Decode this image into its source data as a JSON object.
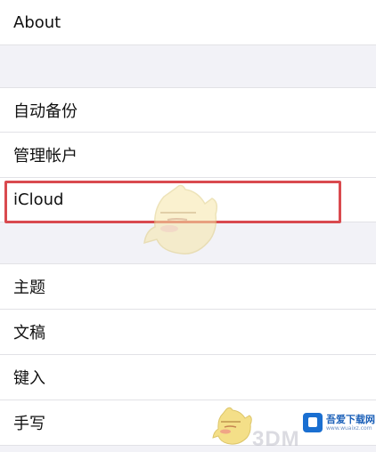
{
  "settings": {
    "about_label": "About",
    "group1": {
      "auto_backup": "自动备份",
      "manage_accounts": "管理帐户",
      "icloud": "iCloud"
    },
    "group2": {
      "theme": "主题",
      "draft": "文稿",
      "keyboard_input": "键入",
      "handwriting": "手写"
    }
  },
  "watermark": {
    "brand": "3DM",
    "site_name": "吾爱下载网",
    "site_url": "www.wuaixz.com"
  },
  "colors": {
    "highlight_border": "#d94a4f",
    "background": "#f2f2f7",
    "row_background": "#ffffff",
    "watermark_logo": "#1a6fd1"
  },
  "icons": {
    "mascot": "cartoon-mascot-watermark"
  }
}
